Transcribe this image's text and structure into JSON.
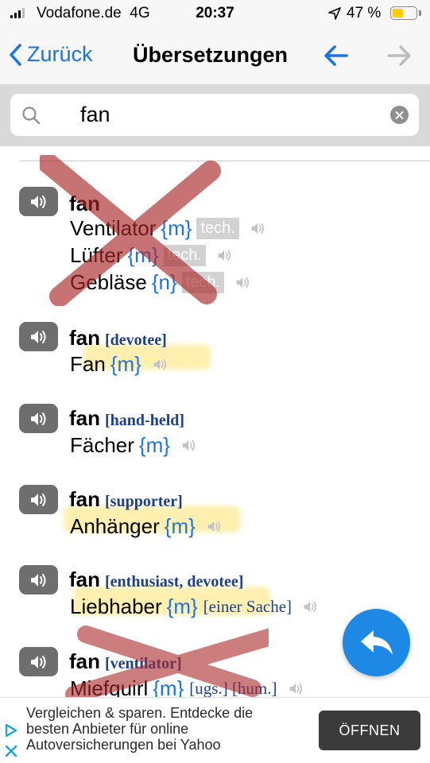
{
  "status": {
    "carrier": "Vodafone.de",
    "network": "4G",
    "time": "20:37",
    "battery_pct": "47 %",
    "battery_level": 0.47,
    "battery_color": "#ffcc00"
  },
  "nav": {
    "back_label": "Zurück",
    "title": "Übersetzungen",
    "accent": "#1a73e8"
  },
  "search": {
    "value": "fan",
    "placeholder": ""
  },
  "entries": [
    {
      "headword": "fan",
      "qualifier": "",
      "translations": [
        {
          "word": "Ventilator",
          "gender": "{m}",
          "tag": "tech."
        },
        {
          "word": "Lüfter",
          "gender": "{m}",
          "tag": "tech."
        },
        {
          "word": "Gebläse",
          "gender": "{n}",
          "tag": "tech."
        }
      ]
    },
    {
      "headword": "fan",
      "qualifier": "[devotee]",
      "translations": [
        {
          "word": "Fan",
          "gender": "{m}"
        }
      ]
    },
    {
      "headword": "fan",
      "qualifier": "[hand-held]",
      "translations": [
        {
          "word": "Fächer",
          "gender": "{m}"
        }
      ]
    },
    {
      "headword": "fan",
      "qualifier": "[supporter]",
      "translations": [
        {
          "word": "Anhänger",
          "gender": "{m}"
        }
      ]
    },
    {
      "headword": "fan",
      "qualifier": "[enthusiast, devotee]",
      "translations": [
        {
          "word": "Liebhaber",
          "gender": "{m}",
          "note": "[einer Sache]"
        }
      ]
    },
    {
      "headword": "fan",
      "qualifier": "[ventilator]",
      "translations": [
        {
          "word": "Miefquirl",
          "gender": "{m}",
          "note": "[ugs.] [hum.]"
        }
      ]
    }
  ],
  "ad": {
    "text": "Vergleichen & sparen. Entdecke die besten Anbieter für online Autoversicherungen bei Yahoo",
    "button": "ÖFFNEN"
  }
}
